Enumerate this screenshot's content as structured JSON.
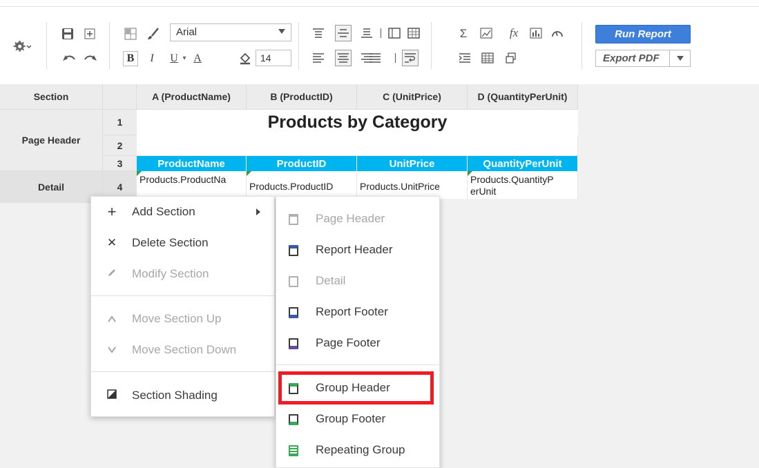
{
  "toolbar": {
    "font_name": "Arial",
    "font_size": "14",
    "bold": "B",
    "italic": "I",
    "underline": "U",
    "font_color": "A",
    "sum_symbol": "Σ",
    "fx_symbol": "fx",
    "run_report": "Run Report",
    "export_label": "Export PDF",
    "colors": {
      "run_button": "#3f7fdc",
      "header_fill": "#00b4ef",
      "highlight": "#ef1c24"
    }
  },
  "sheet": {
    "corner_label": "Section",
    "columns": [
      "A (ProductName)",
      "B (ProductID)",
      "C (UnitPrice)",
      "D (QuantityPerUnit)"
    ],
    "sections": [
      {
        "label": "Page Header",
        "rows": [
          "1",
          "2",
          "3"
        ]
      },
      {
        "label": "Detail",
        "rows": [
          "4"
        ]
      }
    ],
    "title": "Products by Category",
    "header_row": [
      "ProductName",
      "ProductID",
      "UnitPrice",
      "QuantityPerUnit"
    ],
    "detail_row": [
      "Products.ProductNa",
      "Products.ProductID",
      "Products.UnitPrice",
      "Products.QuantityP",
      "erUnit"
    ]
  },
  "context_menu": {
    "items": [
      {
        "label": "Add Section",
        "icon": "plus-icon",
        "enabled": true
      },
      {
        "label": "Delete Section",
        "icon": "close-icon",
        "enabled": true
      },
      {
        "label": "Modify Section",
        "icon": "pencil-icon",
        "enabled": false
      },
      {
        "label": "Move Section Up",
        "icon": "chevron-up-icon",
        "enabled": false
      },
      {
        "label": "Move Section Down",
        "icon": "chevron-down-icon",
        "enabled": false
      },
      {
        "label": "Section Shading",
        "icon": "shading-icon",
        "enabled": true
      }
    ]
  },
  "submenu": {
    "items": [
      {
        "label": "Page Header",
        "icon": "page-header-icon",
        "enabled": false
      },
      {
        "label": "Report Header",
        "icon": "report-header-icon",
        "enabled": true
      },
      {
        "label": "Detail",
        "icon": "detail-icon",
        "enabled": false
      },
      {
        "label": "Report Footer",
        "icon": "report-footer-icon",
        "enabled": true
      },
      {
        "label": "Page Footer",
        "icon": "page-footer-icon",
        "enabled": true
      },
      {
        "label": "Group Header",
        "icon": "group-header-icon",
        "enabled": true,
        "highlighted": true
      },
      {
        "label": "Group Footer",
        "icon": "group-footer-icon",
        "enabled": true
      },
      {
        "label": "Repeating Group",
        "icon": "repeating-group-icon",
        "enabled": true
      }
    ]
  }
}
